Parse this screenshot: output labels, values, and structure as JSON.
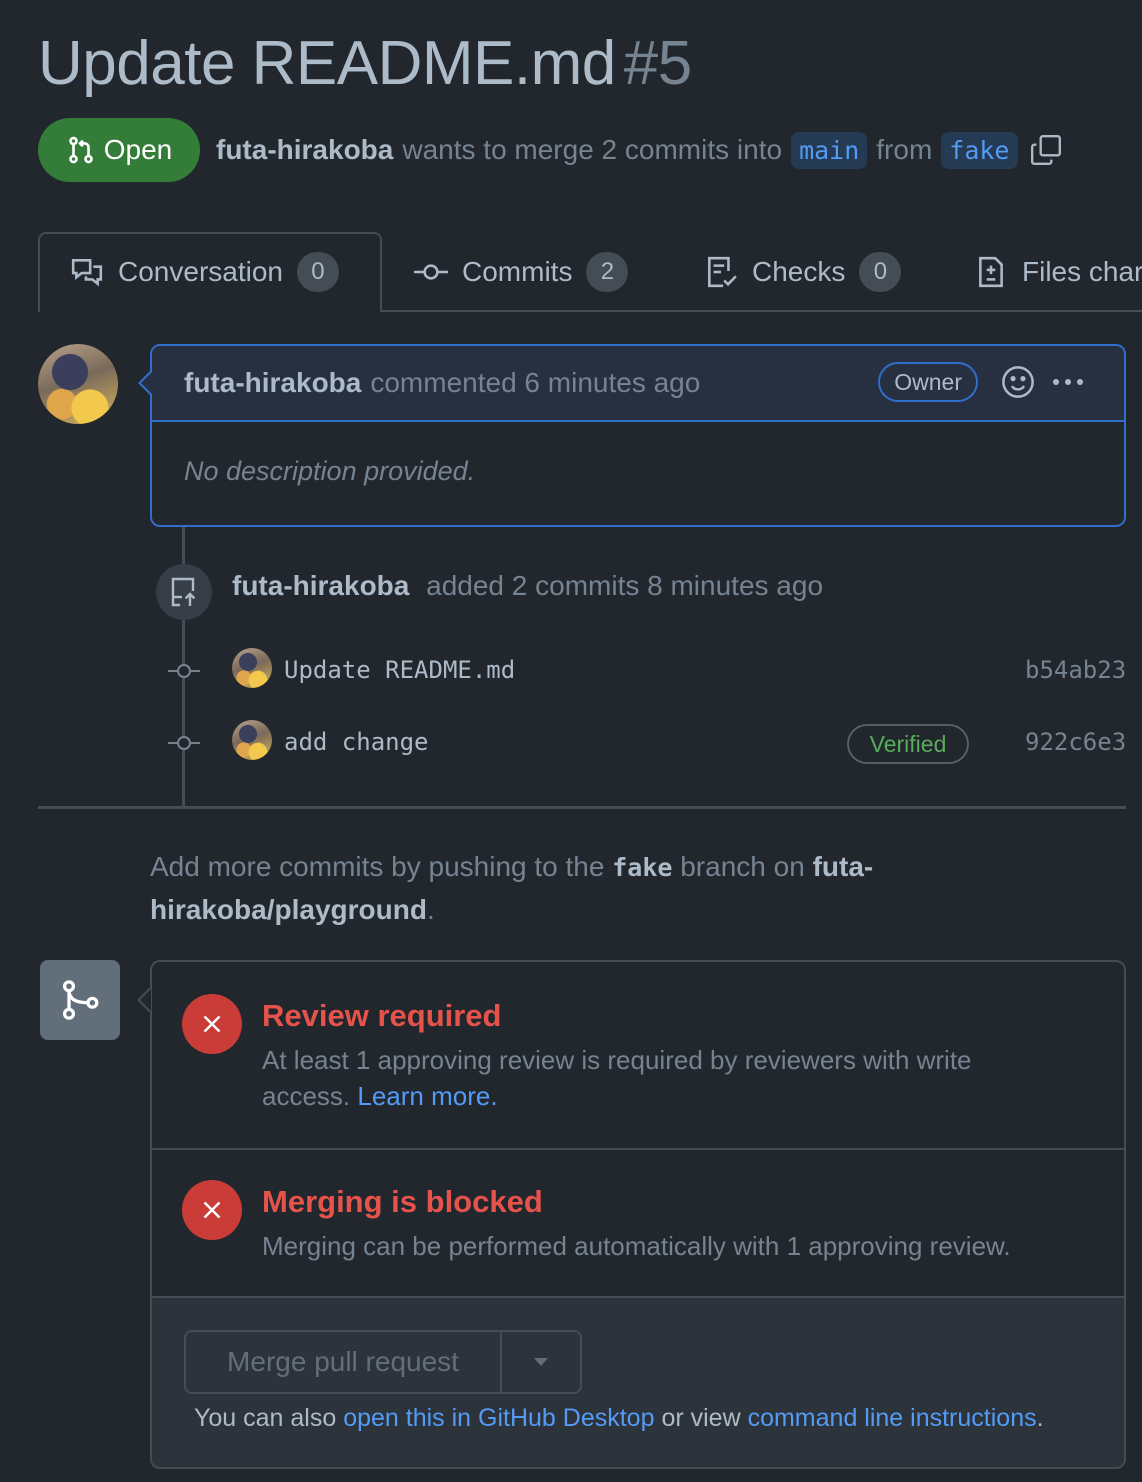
{
  "pr": {
    "title": "Update README.md",
    "number": "#5",
    "state": "Open",
    "author": "futa-hirakoba",
    "merge_text": "wants to merge 2 commits into",
    "base_branch": "main",
    "from_text": "from",
    "head_branch": "fake"
  },
  "tabs": [
    {
      "label": "Conversation",
      "count": "0",
      "icon": "comment-discussion-icon"
    },
    {
      "label": "Commits",
      "count": "2",
      "icon": "git-commit-icon"
    },
    {
      "label": "Checks",
      "count": "0",
      "icon": "checklist-icon"
    },
    {
      "label": "Files char",
      "icon": "file-diff-icon"
    }
  ],
  "comment": {
    "author": "futa-hirakoba",
    "action": "commented 6 minutes ago",
    "role": "Owner",
    "body": "No description provided."
  },
  "timeline": {
    "author": "futa-hirakoba",
    "event": "added 2 commits 8 minutes ago",
    "commits": [
      {
        "message": "Update README.md",
        "sha": "b54ab23",
        "verified": ""
      },
      {
        "message": "add change",
        "sha": "922c6e3",
        "verified": "Verified"
      }
    ]
  },
  "push_note": {
    "prefix": "Add more commits by pushing to the",
    "branch": "fake",
    "middle": "branch on",
    "repo": "futa-hirakoba/playground",
    "suffix": "."
  },
  "merge": {
    "review_title": "Review required",
    "review_desc": "At least 1 approving review is required by reviewers with write access.",
    "review_link": "Learn more.",
    "blocked_title": "Merging is blocked",
    "blocked_desc": "Merging can be performed automatically with 1 approving review.",
    "button_label": "Merge pull request",
    "also_prefix": "You can also",
    "desktop_link": "open this in GitHub Desktop",
    "also_middle": "or view",
    "cli_link": "command line instructions",
    "also_suffix": "."
  },
  "colors": {
    "background": "#22272e",
    "open_green": "#347d39",
    "link_blue": "#539bf5",
    "error_red": "#e5534b",
    "verified_green": "#57ab5a"
  }
}
